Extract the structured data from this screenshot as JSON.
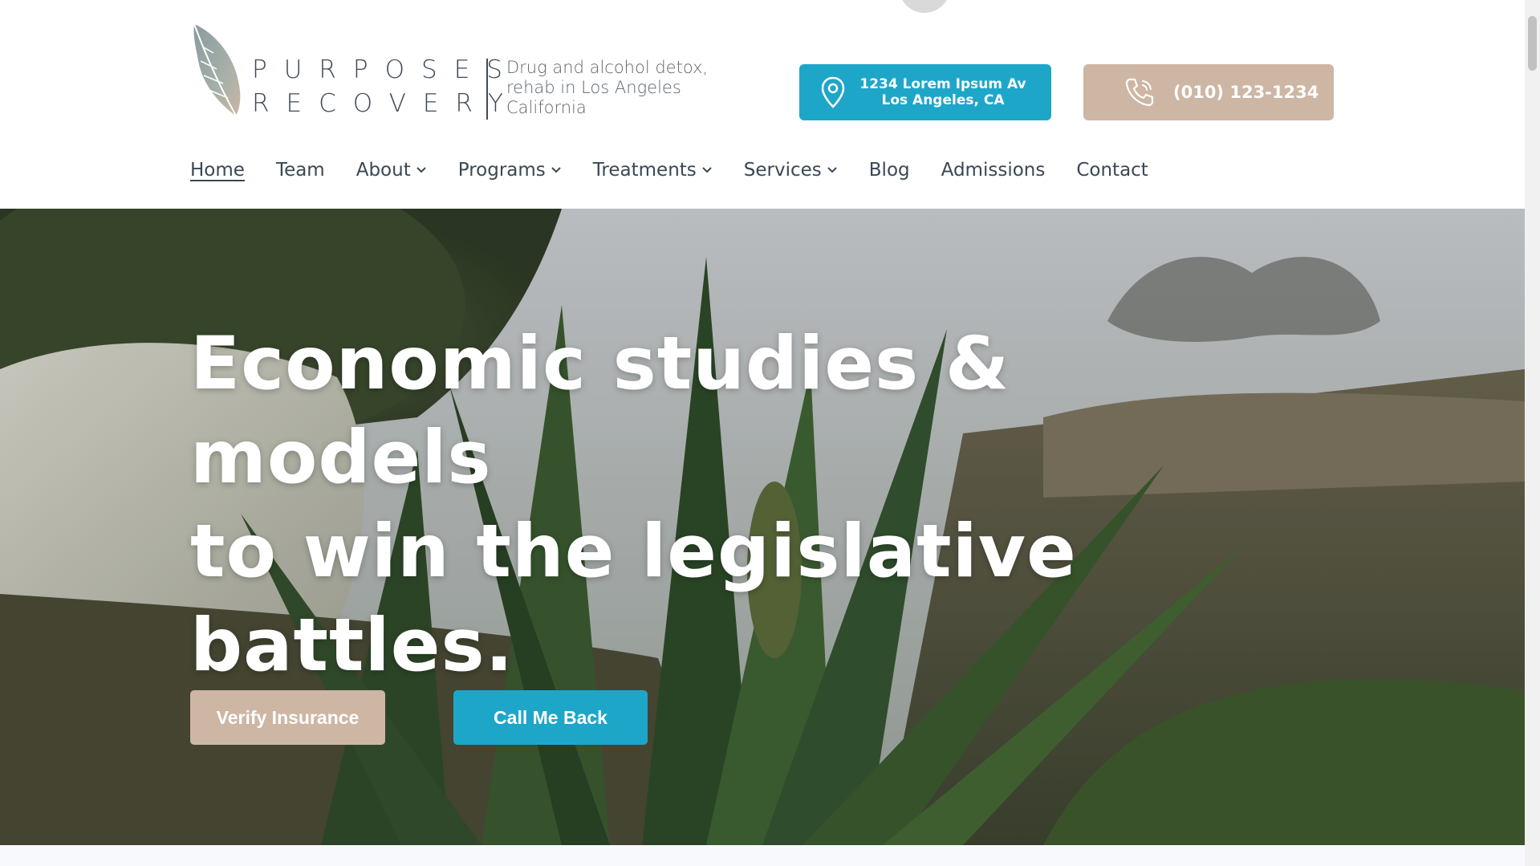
{
  "brand": {
    "line1": "PURPOSES",
    "line2": "RECOVERY",
    "tagline": "Drug and alcohol detox, rehab in Los Angeles California",
    "logo_icon": "feather-icon"
  },
  "header": {
    "address_line1": "1234 Lorem Ipsum Av",
    "address_line2": "Los Angeles, CA",
    "address_icon": "location-pin-icon",
    "phone": "(010) 123-1234",
    "phone_icon": "phone-icon"
  },
  "nav": {
    "items": [
      {
        "label": "Home",
        "active": true,
        "dropdown": false
      },
      {
        "label": "Team",
        "active": false,
        "dropdown": false
      },
      {
        "label": "About",
        "active": false,
        "dropdown": true
      },
      {
        "label": "Programs",
        "active": false,
        "dropdown": true
      },
      {
        "label": "Treatments",
        "active": false,
        "dropdown": true
      },
      {
        "label": "Services",
        "active": false,
        "dropdown": true
      },
      {
        "label": "Blog",
        "active": false,
        "dropdown": false
      },
      {
        "label": "Admissions",
        "active": false,
        "dropdown": false
      },
      {
        "label": "Contact",
        "active": false,
        "dropdown": false
      }
    ]
  },
  "hero": {
    "title_line1": "Economic studies & models",
    "title_line2": "to win the legislative",
    "title_line3": "battles.",
    "verify_label": "Verify Insurance",
    "call_label": "Call Me Back"
  },
  "colors": {
    "accent_blue": "#1ea6c9",
    "accent_tan": "#cdb6a3",
    "text_dark": "#3a4754"
  }
}
